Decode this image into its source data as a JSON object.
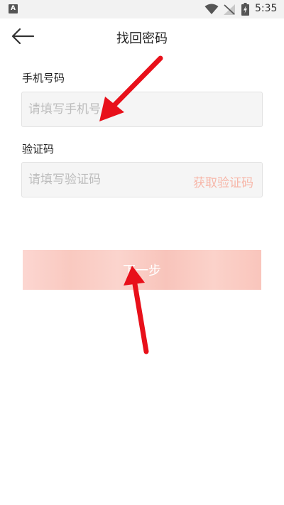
{
  "status_bar": {
    "notification_badge": "A",
    "time": "5:35",
    "icons": [
      "wifi-icon",
      "signal-off-icon",
      "battery-charging-icon"
    ]
  },
  "nav": {
    "title": "找回密码",
    "back_icon": "arrow-left-icon"
  },
  "form": {
    "phone_label": "手机号码",
    "phone_placeholder": "请填写手机号",
    "phone_value": "",
    "code_label": "验证码",
    "code_placeholder": "请填写验证码",
    "code_value": "",
    "get_code_label": "获取验证码",
    "next_label": "下一步"
  },
  "colors": {
    "accent_light": "#f7b6a8",
    "button_fill": "#f9c9c0",
    "annotation_arrow": "#e8101a",
    "input_bg": "#f5f5f5"
  }
}
